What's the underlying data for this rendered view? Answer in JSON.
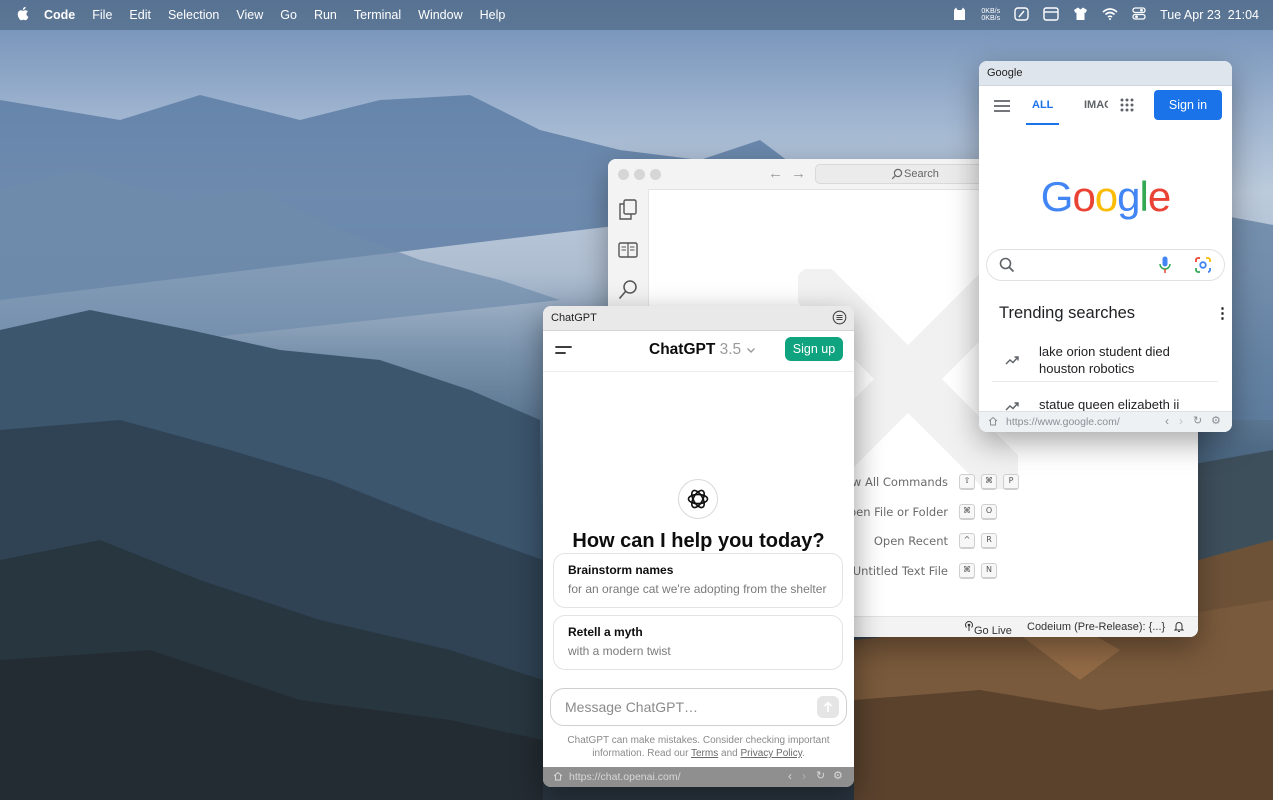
{
  "menubar": {
    "apple": "",
    "app_name": "Code",
    "menus": [
      "File",
      "Edit",
      "Selection",
      "View",
      "Go",
      "Run",
      "Terminal",
      "Window",
      "Help"
    ],
    "net_up": "0KB/s",
    "net_down": "0KB/s",
    "datetime": "Tue Apr 23  21:04"
  },
  "vscode": {
    "nav_back": "←",
    "nav_forward": "→",
    "search_label": "Search",
    "commands": [
      {
        "label": "Show All Commands",
        "keys": [
          "⇧",
          "⌘",
          "P"
        ]
      },
      {
        "label": "Open File or Folder",
        "keys": [
          "⌘",
          "O"
        ]
      },
      {
        "label": "Open Recent",
        "keys": [
          "^",
          "R"
        ]
      },
      {
        "label": "New Untitled Text File",
        "keys": [
          "⌘",
          "N"
        ]
      }
    ],
    "status_golive": "Go Live",
    "status_codeium": "Codeium (Pre-Release): {...}"
  },
  "chatgpt": {
    "window_title": "ChatGPT",
    "model_name": "ChatGPT",
    "model_version": "3.5",
    "signup_label": "Sign up",
    "heading": "How can I help you today?",
    "suggestions": [
      {
        "title": "Brainstorm names",
        "subtitle": "for an orange cat we're adopting from the shelter"
      },
      {
        "title": "Retell a myth",
        "subtitle": "with a modern twist"
      }
    ],
    "input_placeholder": "Message ChatGPT…",
    "disclaimer_1": "ChatGPT can make mistakes. Consider checking important",
    "disclaimer_2a": "information. Read our ",
    "terms": "Terms",
    "and": " and ",
    "privacy": "Privacy Policy",
    "disclaimer_end": ".",
    "url": "https://chat.openai.com/"
  },
  "google": {
    "window_title": "Google",
    "tab_all": "ALL",
    "tab_images": "IMAGES",
    "signin_label": "Sign in",
    "logo_letters": [
      {
        "ch": "G",
        "color": "#4285F4"
      },
      {
        "ch": "o",
        "color": "#EA4335"
      },
      {
        "ch": "o",
        "color": "#FBBC05"
      },
      {
        "ch": "g",
        "color": "#4285F4"
      },
      {
        "ch": "l",
        "color": "#34A853"
      },
      {
        "ch": "e",
        "color": "#EA4335"
      }
    ],
    "trending_title": "Trending searches",
    "trending": [
      "lake orion student died houston robotics",
      "statue queen elizabeth ii"
    ],
    "url": "https://www.google.com/"
  }
}
